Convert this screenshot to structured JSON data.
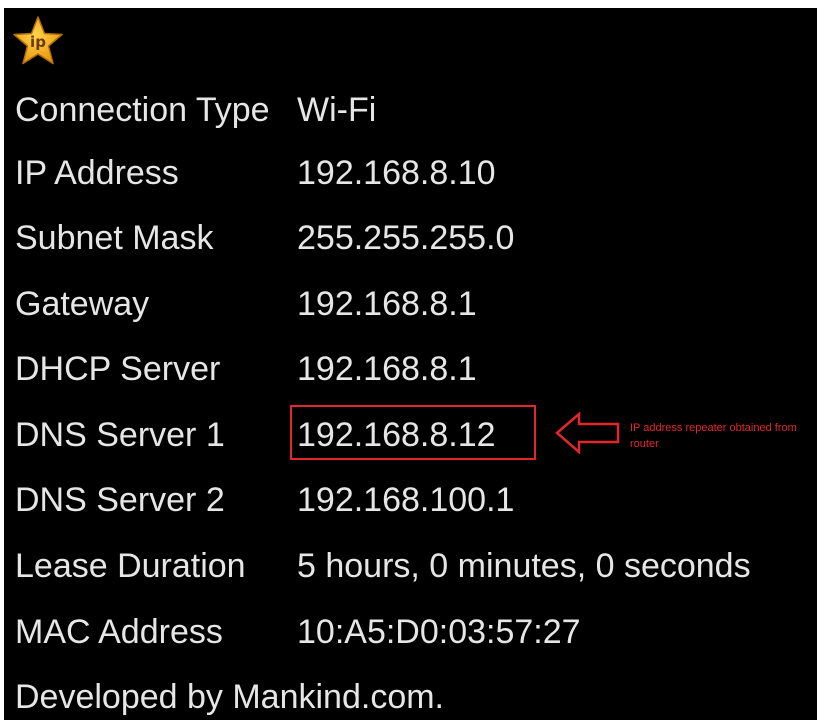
{
  "app": {
    "icon": "ip-star-icon",
    "icon_text": "ip",
    "icon_color": "#f6b21b"
  },
  "rows": [
    {
      "label": "Connection Type",
      "value": "Wi-Fi"
    },
    {
      "label": "IP Address",
      "value": "192.168.8.10"
    },
    {
      "label": "Subnet Mask",
      "value": "255.255.255.0"
    },
    {
      "label": "Gateway",
      "value": "192.168.8.1"
    },
    {
      "label": "DHCP Server",
      "value": "192.168.8.1"
    },
    {
      "label": "DNS Server 1",
      "value": "192.168.8.12"
    },
    {
      "label": "DNS Server 2",
      "value": "192.168.100.1"
    },
    {
      "label": "Lease Duration",
      "value": "5 hours, 0 minutes, 0 seconds"
    },
    {
      "label": "MAC Address",
      "value": "10:A5:D0:03:57:27"
    }
  ],
  "footer": "Developed by Mankind.com.",
  "annotation": {
    "text": "IP address repeater obtained from router",
    "color": "#e3262c",
    "arrow_icon": "left-arrow-icon"
  },
  "colors": {
    "background": "#000000",
    "text": "#e6e6e6"
  }
}
